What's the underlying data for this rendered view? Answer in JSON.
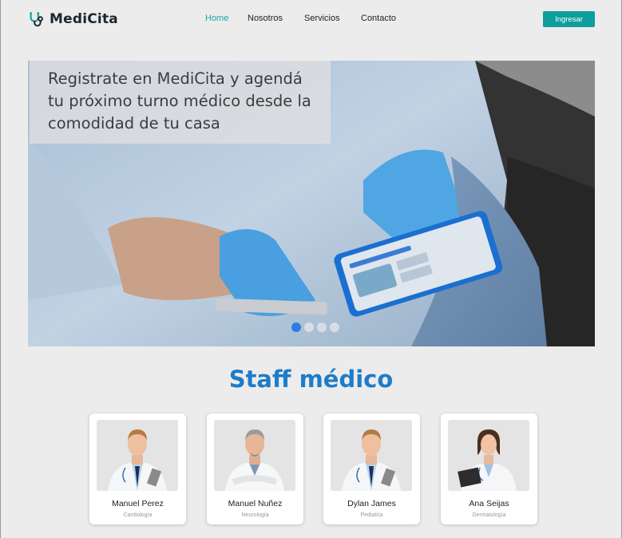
{
  "header": {
    "brand": "MediCita",
    "nav": [
      {
        "label": "Home",
        "active": true
      },
      {
        "label": "Nosotros",
        "active": false
      },
      {
        "label": "Servicios",
        "active": false
      },
      {
        "label": "Contacto",
        "active": false
      }
    ],
    "login_label": "Ingresar"
  },
  "hero": {
    "caption": "Registrate en MediCita y agendá tu próximo turno médico desde la comodidad de tu casa",
    "slide_count": 4,
    "active_slide": 1
  },
  "staff": {
    "title": "Staff médico",
    "members": [
      {
        "name": "Manuel Perez",
        "specialty": "Cardiología"
      },
      {
        "name": "Manuel Nuñez",
        "specialty": "Neurología"
      },
      {
        "name": "Dylan James",
        "specialty": "Pediatría"
      },
      {
        "name": "Ana Seijas",
        "specialty": "Dermatología"
      }
    ]
  },
  "colors": {
    "accent": "#19a6a2",
    "button": "#0e9e9c",
    "title_blue": "#1e7cc8",
    "active_dot": "#2d7de0",
    "background": "#ececed"
  },
  "icons": {
    "logo": "stethoscope-icon"
  }
}
